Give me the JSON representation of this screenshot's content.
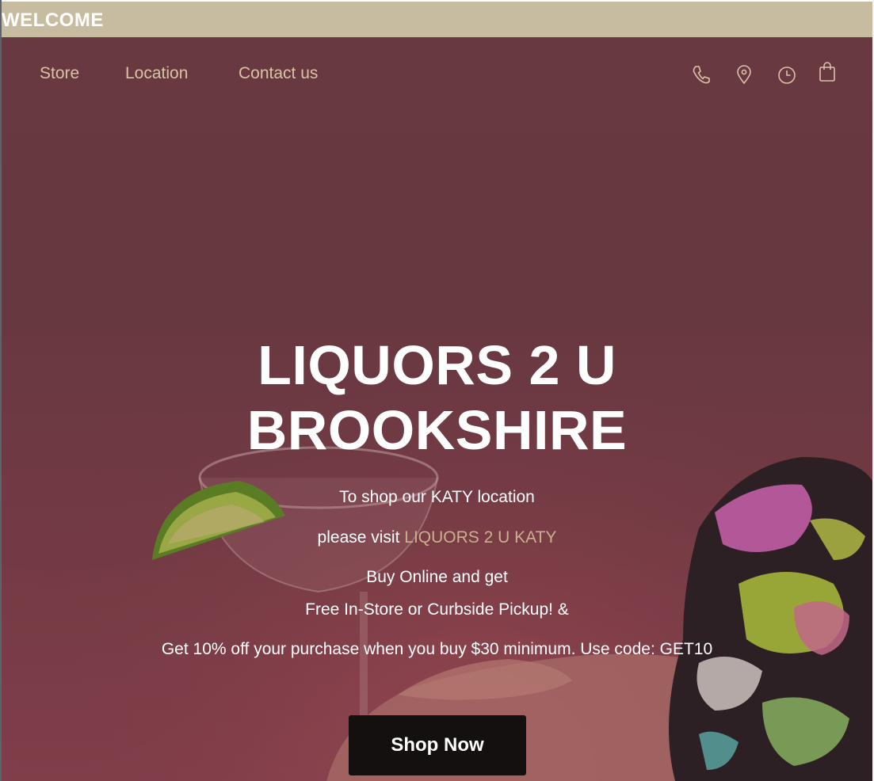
{
  "topbar": {
    "text": "WELCOME"
  },
  "nav": {
    "links": [
      "Store",
      "Location",
      "Contact us"
    ],
    "icons": [
      "phone-icon",
      "map-pin-icon",
      "clock-icon",
      "shopping-bag-icon"
    ]
  },
  "hero": {
    "title_line1": "LIQUORS 2 U",
    "title_line2": "BROOKSHIRE",
    "line1": "To shop our KATY location",
    "line2_prefix": "please visit ",
    "line2_link": "LIQUORS 2 U KATY",
    "line3": "Buy Online and get",
    "line4": "Free In-Store or Curbside Pickup! &",
    "line5": "Get 10% off your purchase when you buy $30 minimum. Use code: GET10",
    "button_label": "Shop Now"
  },
  "colors": {
    "topbar_bg": "#c7bc9f",
    "nav_text": "#d9c3a6",
    "link_accent": "#c9b08f",
    "button_bg": "#141010",
    "hero_bg": "#6d3d45"
  }
}
